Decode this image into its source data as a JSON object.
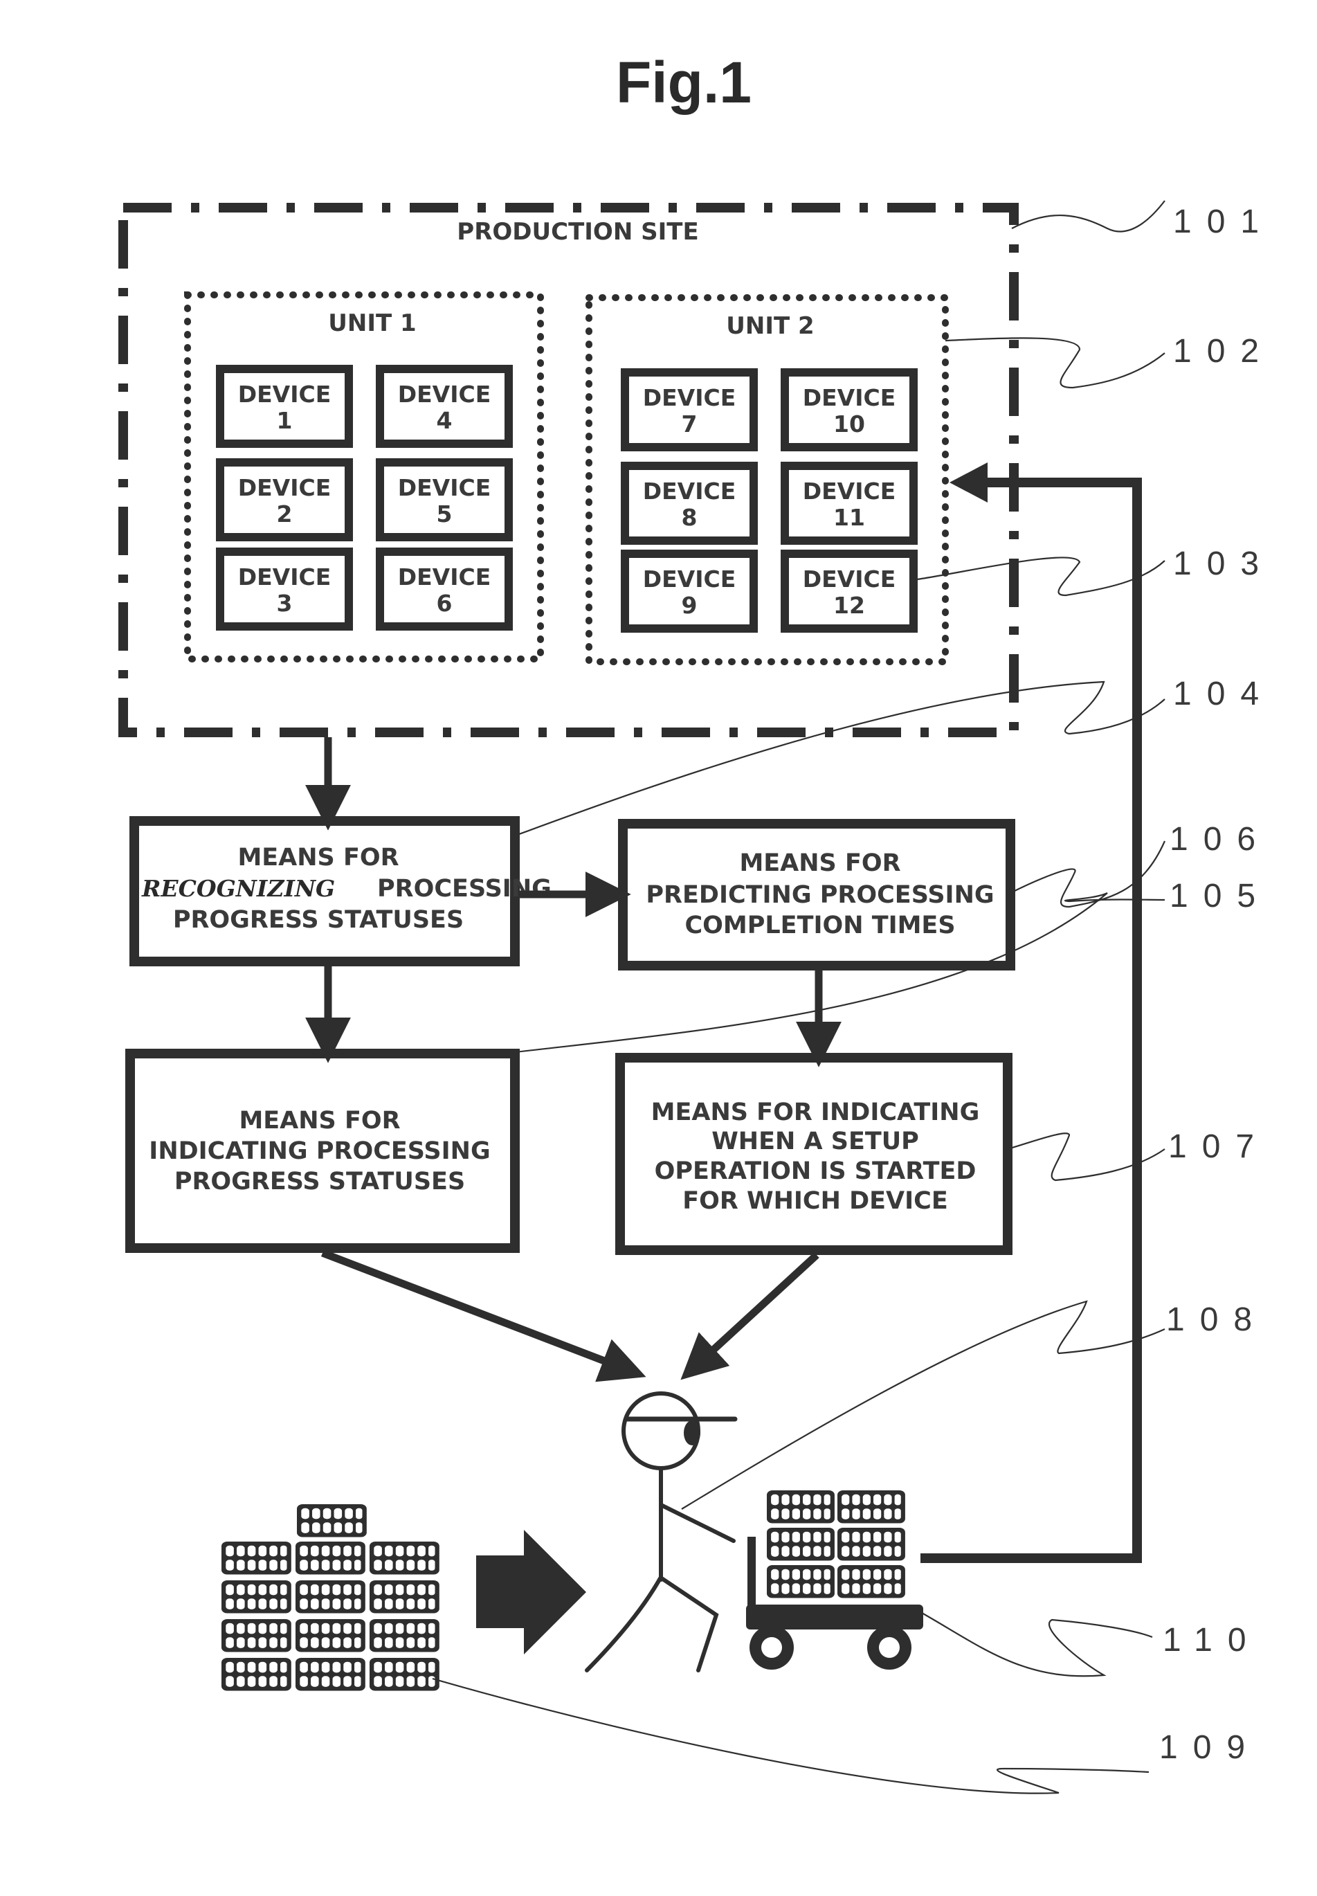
{
  "figure": {
    "title": "Fig.1"
  },
  "production_site": {
    "label": "PRODUCTION SITE",
    "ref": "101"
  },
  "units": [
    {
      "label": "UNIT 1",
      "ref": "",
      "devices": [
        {
          "line1": "DEVICE",
          "line2": "1"
        },
        {
          "line1": "DEVICE",
          "line2": "2"
        },
        {
          "line1": "DEVICE",
          "line2": "3"
        },
        {
          "line1": "DEVICE",
          "line2": "4"
        },
        {
          "line1": "DEVICE",
          "line2": "5"
        },
        {
          "line1": "DEVICE",
          "line2": "6"
        }
      ]
    },
    {
      "label": "UNIT 2",
      "ref": "102",
      "devices": [
        {
          "line1": "DEVICE",
          "line2": "7"
        },
        {
          "line1": "DEVICE",
          "line2": "8"
        },
        {
          "line1": "DEVICE",
          "line2": "9"
        },
        {
          "line1": "DEVICE",
          "line2": "10"
        },
        {
          "line1": "DEVICE",
          "line2": "11"
        },
        {
          "line1": "DEVICE",
          "line2": "12"
        }
      ]
    }
  ],
  "device_ref": "103",
  "blocks": {
    "recognizing": {
      "ref": "104",
      "lines": [
        "MEANS FOR",
        "RECOGNIZING",
        "PROCESSING",
        "PROGRESS STATUSES"
      ]
    },
    "predicting": {
      "ref": "106",
      "lines": [
        "MEANS FOR",
        "PREDICTING PROCESSING",
        "COMPLETION TIMES"
      ]
    },
    "indicating_progress": {
      "ref": "105",
      "lines": [
        "MEANS FOR",
        "INDICATING PROCESSING",
        "PROGRESS STATUSES"
      ]
    },
    "indicating_setup": {
      "ref": "107",
      "lines": [
        "MEANS FOR INDICATING",
        "WHEN A SETUP",
        "OPERATION IS STARTED",
        "FOR WHICH DEVICE"
      ]
    }
  },
  "worker": {
    "ref": "108",
    "icon": "worker-stick-figure-icon"
  },
  "work_stack": {
    "ref": "109",
    "icon": "tray-stack-icon"
  },
  "cart": {
    "ref": "110",
    "icon": "cart-icon"
  },
  "colors": {
    "ink": "#2e2e2e",
    "background": "#ffffff"
  }
}
